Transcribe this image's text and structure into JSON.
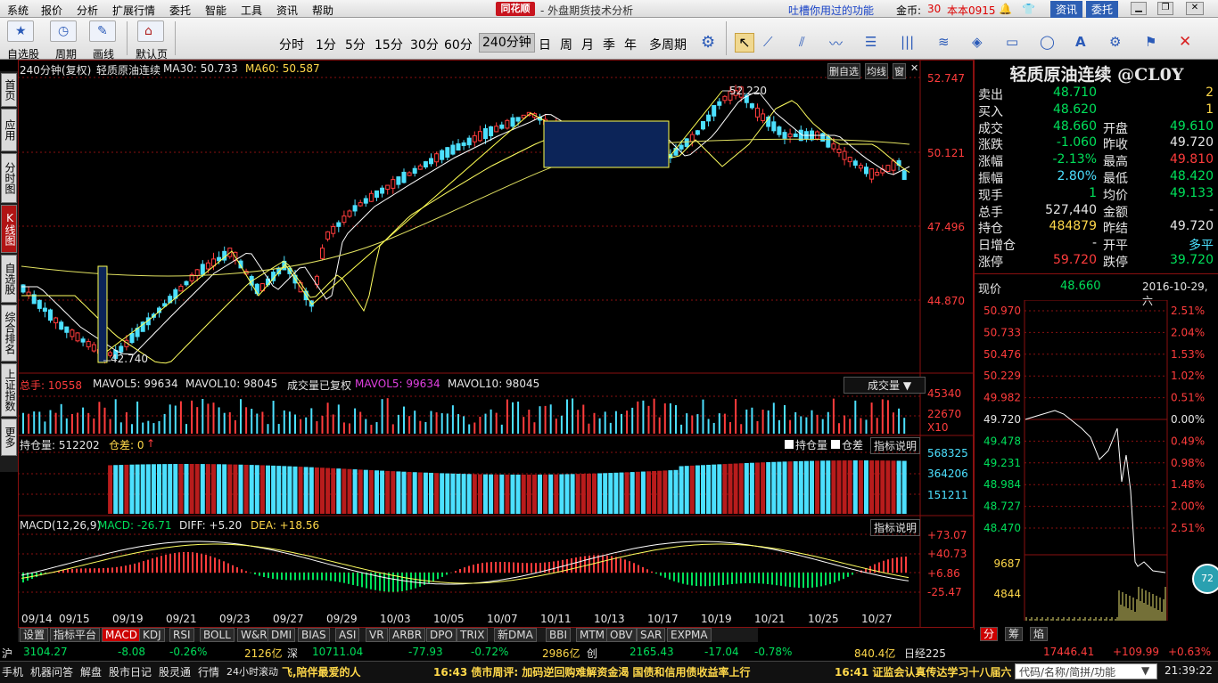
{
  "menu": {
    "items": [
      "系统",
      "报价",
      "分析",
      "扩展行情",
      "委托",
      "智能",
      "工具",
      "资讯",
      "帮助"
    ],
    "logo": "同花顺",
    "subtitle": "- 外盘期货技术分析",
    "promo": "吐槽你用过的功能",
    "gold_label": "金币:",
    "gold_value": "30",
    "version": "本本0915",
    "zixun": "资讯",
    "weituo": "委托"
  },
  "toolbar": {
    "buttons": [
      "自选股",
      "周期",
      "画线",
      "默认页"
    ],
    "periods": [
      "分时",
      "1分",
      "5分",
      "15分",
      "30分",
      "60分",
      "240分钟",
      "日",
      "周",
      "月",
      "季",
      "年",
      "多周期"
    ],
    "active_period": "240分钟"
  },
  "leftnav": [
    "首页",
    "应用",
    "分时图",
    "K线图",
    "自选股",
    "综合排名",
    "上证指数",
    "更多"
  ],
  "chart": {
    "header": {
      "period": "240分钟(复权)",
      "name": "轻质原油连续",
      "ma30_label": "MA30: 50.733",
      "ma60_label": "MA60: 50.587",
      "btn1": "删自选",
      "btn2": "均线",
      "btn3": "窗"
    },
    "price_axis": [
      "52.747",
      "50.121",
      "47.496",
      "44.870"
    ],
    "high_label": "52.220",
    "low_label": "42.740",
    "vol": {
      "total_label": "总手: 10558",
      "mavol5": "MAVOL5: 99634",
      "mavol10": "MAVOL10: 98045",
      "adj": "成交量已复权",
      "mavol5b": "MAVOL5: 99634",
      "mavol10b": "MAVOL10: 98045",
      "dropdown": "成交量",
      "axis": [
        "45340",
        "22670",
        "X10"
      ]
    },
    "oi": {
      "label": "持仓量: 512202",
      "diff": "仓差: 0",
      "cb1": "持仓量",
      "cb2": "仓差",
      "explain": "指标说明",
      "axis": [
        "568325",
        "364206",
        "151211"
      ]
    },
    "macd": {
      "label": "MACD(12,26,9)",
      "macd": "MACD: -26.71",
      "diff": "DIFF: +5.20",
      "dea": "DEA: +18.56",
      "explain": "指标说明",
      "axis": [
        "+73.07",
        "+40.73",
        "+6.86",
        "-25.47"
      ]
    },
    "dates": [
      "09/14",
      "09/15",
      "09/19",
      "09/21",
      "09/23",
      "09/27",
      "09/29",
      "10/03",
      "10/05",
      "10/07",
      "10/11",
      "10/13",
      "10/17",
      "10/19",
      "10/21",
      "10/25",
      "10/27"
    ]
  },
  "quote": {
    "title": "轻质原油连续 @CL0Y",
    "rows": [
      {
        "l": "卖出",
        "v": "48.710",
        "l2": "",
        "v2": "2",
        "c": "g",
        "c2": "y"
      },
      {
        "l": "买入",
        "v": "48.620",
        "l2": "",
        "v2": "1",
        "c": "g",
        "c2": "y"
      },
      {
        "l": "成交",
        "v": "48.660",
        "l2": "开盘",
        "v2": "49.610",
        "c": "g",
        "c2": "g"
      },
      {
        "l": "涨跌",
        "v": "-1.060",
        "l2": "昨收",
        "v2": "49.720",
        "c": "g",
        "c2": "w"
      },
      {
        "l": "涨幅",
        "v": "-2.13%",
        "l2": "最高",
        "v2": "49.810",
        "c": "g",
        "c2": "r"
      },
      {
        "l": "振幅",
        "v": "2.80%",
        "l2": "最低",
        "v2": "48.420",
        "c": "c",
        "c2": "g"
      },
      {
        "l": "现手",
        "v": "1",
        "l2": "均价",
        "v2": "49.133",
        "c": "g",
        "c2": "g"
      },
      {
        "l": "总手",
        "v": "527,440",
        "l2": "金额",
        "v2": "-",
        "c": "w",
        "c2": "w"
      },
      {
        "l": "持仓",
        "v": "484879",
        "l2": "昨结",
        "v2": "49.720",
        "c": "y",
        "c2": "w"
      },
      {
        "l": "日增仓",
        "v": "-",
        "l2": "开平",
        "v2": "多平",
        "c": "w",
        "c2": "c"
      },
      {
        "l": "涨停",
        "v": "59.720",
        "l2": "跌停",
        "v2": "39.720",
        "c": "r",
        "c2": "g"
      }
    ],
    "now_label": "现价",
    "now_value": "48.660",
    "date": "2016-10-29,六",
    "mini_left": [
      "50.970",
      "50.733",
      "50.476",
      "50.229",
      "49.982",
      "49.720",
      "49.478",
      "49.231",
      "48.984",
      "48.727",
      "48.470",
      "9687",
      "4844"
    ],
    "mini_right": [
      "2.51%",
      "2.04%",
      "1.53%",
      "1.02%",
      "0.51%",
      "0.00%",
      "0.49%",
      "0.98%",
      "1.48%",
      "2.00%",
      "2.51%"
    ],
    "tabs": [
      "分",
      "筹",
      "焰"
    ],
    "bubble": "72"
  },
  "bottom_tabs": [
    "设置",
    "指标平台",
    "MACD",
    "KDJ",
    "RSI",
    "BOLL",
    "W&R",
    "DMI",
    "BIAS",
    "ASI",
    "VR",
    "ARBR",
    "DPO",
    "TRIX",
    "新DMA",
    "BBI",
    "MTM",
    "OBV",
    "SAR",
    "EXPMA"
  ],
  "index_bar": {
    "sh": "沪",
    "sh_val": "3104.27",
    "sh_chg": "-8.08",
    "sh_pct": "-0.26%",
    "sh_amt": "2126亿",
    "sz": "深",
    "sz_val": "10711.04",
    "sz_chg": "-77.93",
    "sz_pct": "-0.72%",
    "sz_amt": "2986亿",
    "cy": "创",
    "cy_val": "2165.43",
    "cy_chg": "-17.04",
    "cy_pct": "-0.78%",
    "cy_amt": "840.4亿",
    "nk": "日经225",
    "nk_val": "17446.41",
    "nk_chg": "+109.99",
    "nk_pct": "+0.63%"
  },
  "status": {
    "items": [
      "手机",
      "机器问答",
      "解盘",
      "股市日记",
      "股灵通",
      "行情",
      "24小时滚动"
    ],
    "news1": "飞,陪伴最爱的人",
    "news2": "16:43 债市周评: 加码逆回购难解资金渴 国债和信用债收益率上行",
    "news3": "16:41 证监会认真传达学习十八届六",
    "search": "代码/名称/简拼/功能",
    "clock": "21:39:22"
  }
}
